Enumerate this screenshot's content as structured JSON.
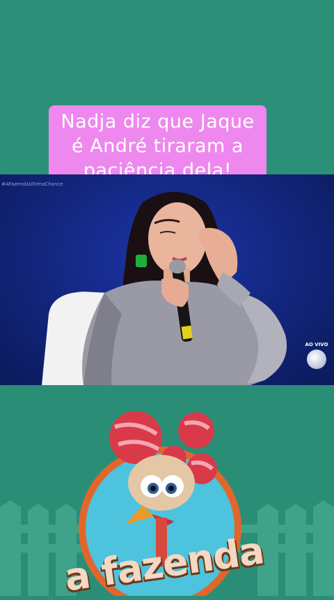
{
  "caption": {
    "lines": [
      "Nadja diz que Jaque",
      "é André tiraram a",
      "paciência dela!"
    ]
  },
  "video": {
    "watermark": "#AFazendaUltimaChance",
    "live_label": "AO VIVO"
  },
  "logo": {
    "text": "a fazenda"
  },
  "colors": {
    "background": "#2c9079",
    "caption_bg": "#ee88ee",
    "video_bg": "#142884"
  }
}
